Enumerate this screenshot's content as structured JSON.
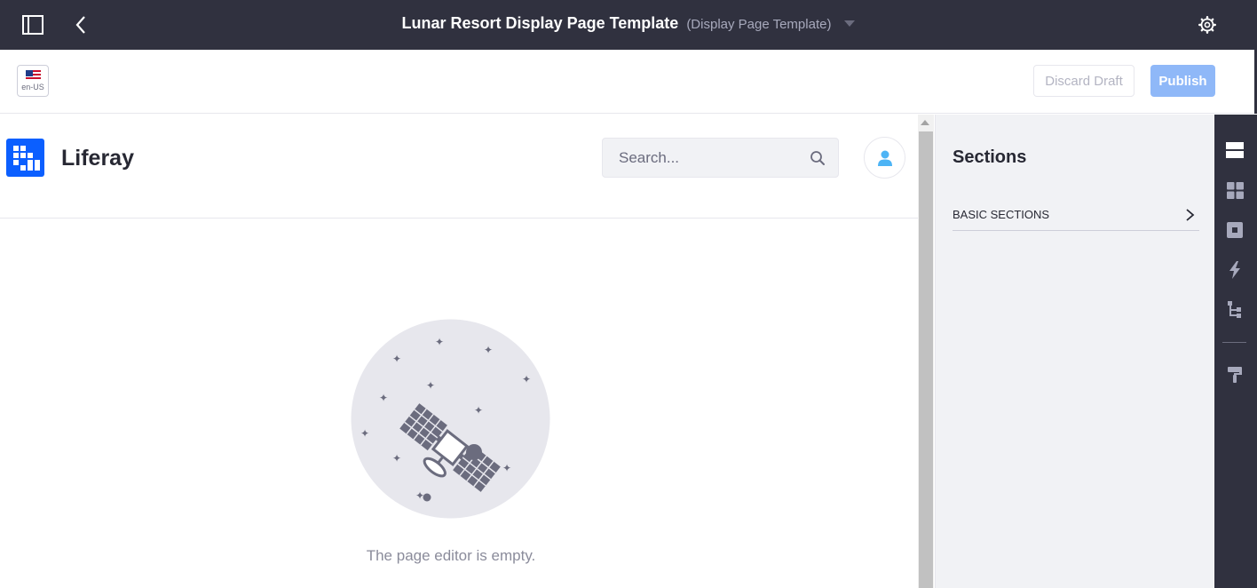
{
  "topbar": {
    "title": "Lunar Resort Display Page Template",
    "subtitle": "(Display Page Template)",
    "icons": [
      "sidebar-toggle-icon",
      "back-icon",
      "caret-down-icon",
      "gear-icon"
    ]
  },
  "toolbar": {
    "language_label": "en-US",
    "discard_label": "Discard Draft",
    "publish_label": "Publish"
  },
  "site": {
    "name": "Liferay",
    "search_placeholder": "Search..."
  },
  "editor": {
    "empty_message": "The page editor is empty."
  },
  "sidebar": {
    "title": "Sections",
    "panels": [
      {
        "label": "BASIC SECTIONS"
      }
    ],
    "icons": [
      "sections-icon",
      "fragments-icon",
      "widgets-icon",
      "mapping-icon",
      "page-structure-icon",
      "theme-icon"
    ]
  },
  "colors": {
    "topbar_bg": "#30313f",
    "publish_bg": "#8fb8f8",
    "logo_blue": "#0b5fff",
    "panel_bg": "#f1f2f5"
  }
}
